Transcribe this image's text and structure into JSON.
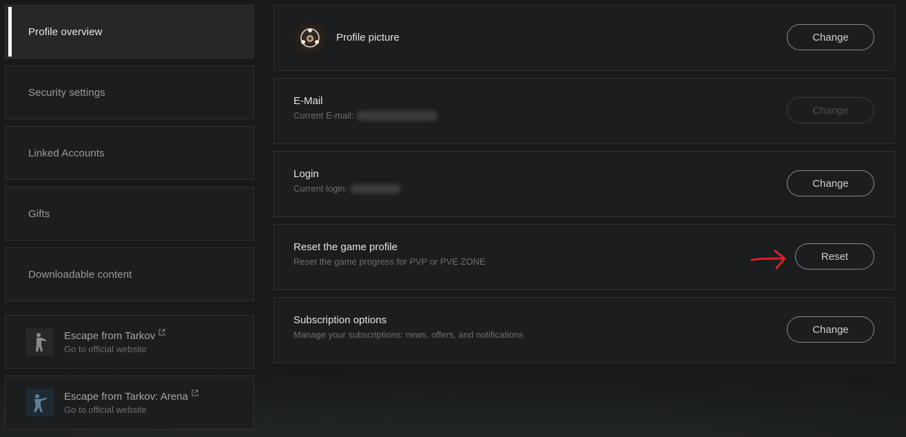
{
  "sidebar": {
    "items": [
      {
        "label": "Profile overview",
        "active": true
      },
      {
        "label": "Security settings"
      },
      {
        "label": "Linked Accounts"
      },
      {
        "label": "Gifts"
      },
      {
        "label": "Downloadable content"
      }
    ],
    "games": [
      {
        "title": "Escape from Tarkov",
        "subtitle": "Go to official website",
        "icon": "soldier-icon"
      },
      {
        "title": "Escape from Tarkov: Arena",
        "subtitle": "Go to official website",
        "icon": "soldier-arena-icon"
      }
    ]
  },
  "main": {
    "profile_picture": {
      "title": "Profile picture",
      "button": "Change"
    },
    "email": {
      "title": "E-Mail",
      "subtitle": "Current E-mail:",
      "button": "Change",
      "button_enabled": false
    },
    "login": {
      "title": "Login",
      "subtitle": "Current login:",
      "button": "Change"
    },
    "reset": {
      "title": "Reset the game profile",
      "subtitle": "Reset the game progress for PVP or PVE ZONE",
      "button": "Reset"
    },
    "subscription": {
      "title": "Subscription options",
      "subtitle": "Manage your subscriptions: news, offers, and notifications",
      "button": "Change"
    }
  },
  "colors": {
    "background": "#17191a",
    "panel": "#1b1d1e",
    "border": "#2f3233",
    "annotation_arrow": "#d9202b"
  }
}
